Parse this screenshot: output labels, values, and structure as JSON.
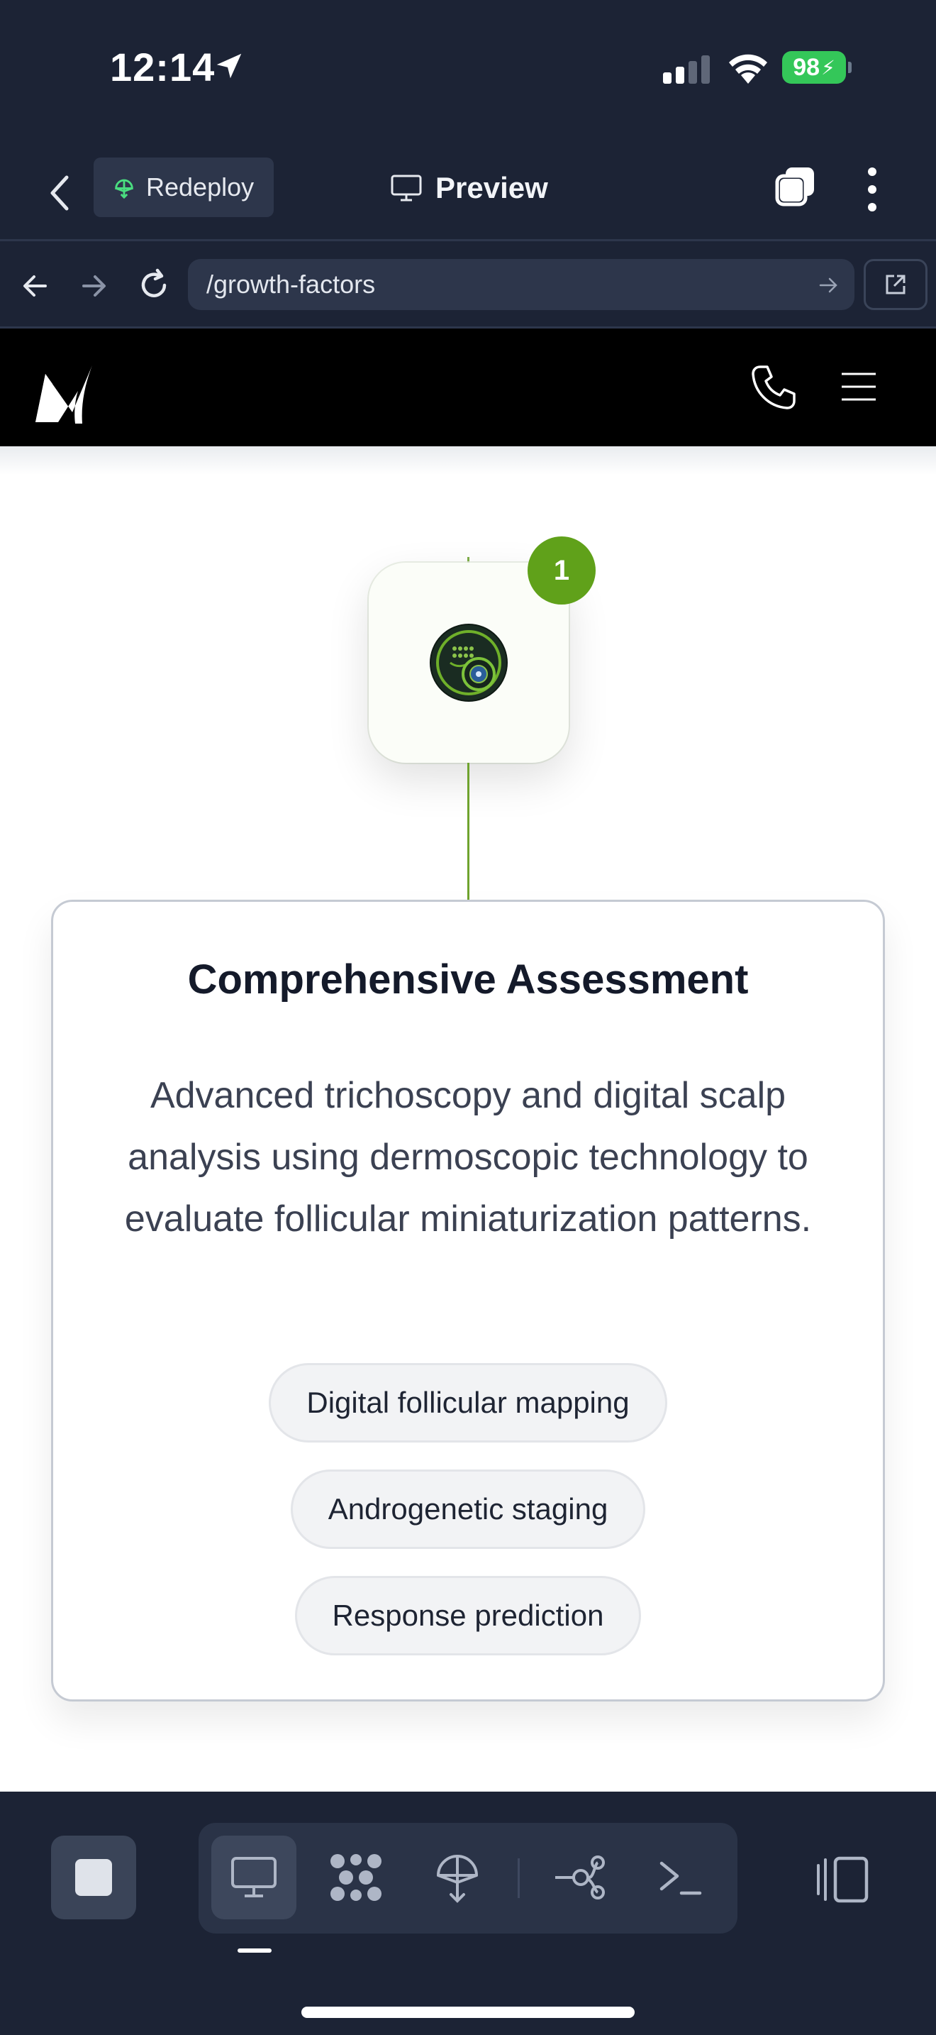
{
  "status_bar": {
    "time": "12:14",
    "battery": "98"
  },
  "app_toolbar": {
    "redeploy_label": "Redeploy",
    "preview_label": "Preview"
  },
  "browser": {
    "url": "/growth-factors"
  },
  "site": {
    "step": {
      "number": "1",
      "title": "Comprehensive Assessment",
      "description": "Advanced trichoscopy and digital scalp analysis using dermoscopic technology to evaluate follicular miniaturization patterns.",
      "tags": [
        "Digital follicular mapping",
        "Androgenetic staging",
        "Response prediction"
      ]
    }
  },
  "bottom_toolbar": {
    "tools": [
      "desktop-icon",
      "apps-icon",
      "deploy-icon",
      "git-icon",
      "terminal-icon"
    ],
    "active_tool": "desktop-icon"
  },
  "colors": {
    "app_bg": "#1c2335",
    "accent_green": "#60a11a",
    "battery_green": "#34c759"
  }
}
